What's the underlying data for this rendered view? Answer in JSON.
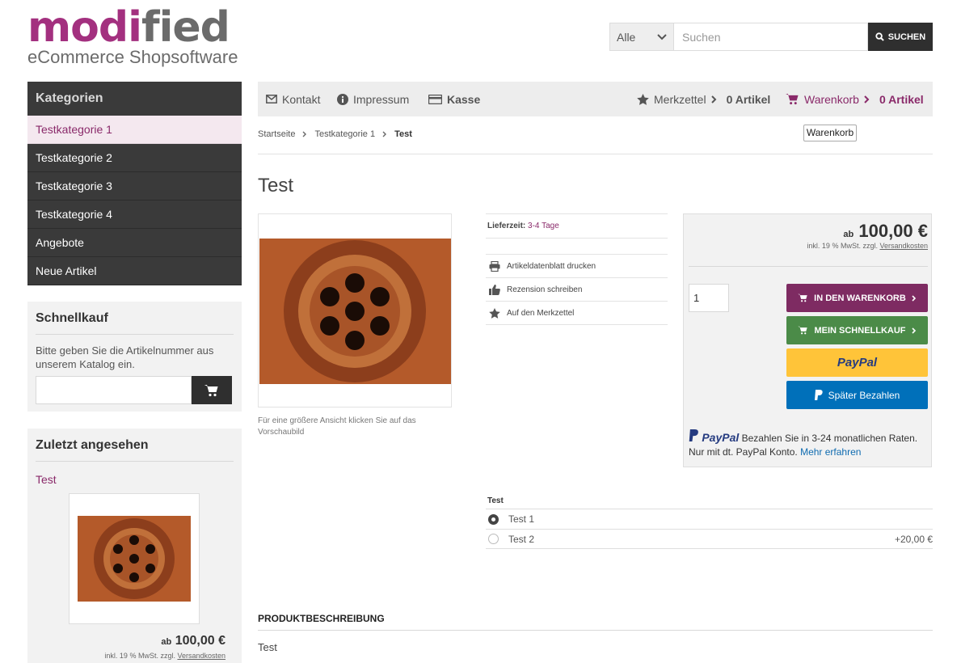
{
  "logo": {
    "word_part1": "mod",
    "word_part2": "i",
    "word_part3": "fied",
    "tagline": "eCommerce Shopsoftware"
  },
  "search": {
    "category": "Alle",
    "placeholder": "Suchen",
    "button": "SUCHEN"
  },
  "sidebar": {
    "categories_title": "Kategorien",
    "categories": [
      {
        "label": "Testkategorie 1"
      },
      {
        "label": "Testkategorie 2"
      },
      {
        "label": "Testkategorie 3"
      },
      {
        "label": "Testkategorie 4"
      },
      {
        "label": "Angebote"
      },
      {
        "label": "Neue Artikel"
      }
    ],
    "quickbuy": {
      "title": "Schnellkauf",
      "text": "Bitte geben Sie die Artikelnummer aus unserem Katalog ein."
    },
    "recent": {
      "title": "Zuletzt angesehen",
      "item": "Test",
      "price_prefix": "ab",
      "price": "100,00 €",
      "tax_text": "inkl. 19 % MwSt. zzgl. ",
      "shipping_link": "Versandkosten"
    }
  },
  "navbar": {
    "contact": "Kontakt",
    "imprint": "Impressum",
    "checkout": "Kasse",
    "wishlist": "Merkzettel",
    "wishlist_count": "0 Artikel",
    "cart": "Warenkorb",
    "cart_count": "0 Artikel"
  },
  "breadcrumb": {
    "items": [
      "Startseite",
      "Testkategorie 1",
      "Test"
    ]
  },
  "tooltip": "Warenkorb",
  "product": {
    "title": "Test",
    "image_hint": "Für eine größere Ansicht klicken Sie auf das Vorschaubild",
    "delivery_label": "Lieferzeit:",
    "delivery_value": "3-4 Tage",
    "actions": [
      {
        "label": "Artikeldatenblatt drucken"
      },
      {
        "label": "Rezension schreiben"
      },
      {
        "label": "Auf den Merkzettel"
      }
    ],
    "price_prefix": "ab",
    "price": "100,00 €",
    "tax_text": "inkl. 19 % MwSt. zzgl. ",
    "shipping_link": "Versandkosten",
    "quantity": "1",
    "btn_cart": "IN DEN WARENKORB",
    "btn_quick": "MEIN SCHNELLKAUF",
    "btn_paypal": "PayPal",
    "btn_later": "Später Bezahlen",
    "paypal_brand": "PayPal",
    "paypal_text": "Bezahlen Sie in 3-24 monatlichen Raten. Nur mit dt. PayPal Konto.",
    "paypal_link": "Mehr erfahren",
    "option_label": "Test",
    "options": [
      {
        "label": "Test 1",
        "price": "",
        "selected": true
      },
      {
        "label": "Test 2",
        "price": "+20,00 €",
        "selected": false
      }
    ],
    "desc_heading": "PRODUKTBESCHREIBUNG",
    "desc_text": "Test"
  },
  "colors": {
    "brand_purple": "#8a2a6a",
    "cart_button": "#7e2b62",
    "quick_button": "#4b8b48",
    "paypal_yellow": "#ffc439",
    "paypal_blue": "#0070ba",
    "sidebar_dark": "#3a3a3a"
  }
}
